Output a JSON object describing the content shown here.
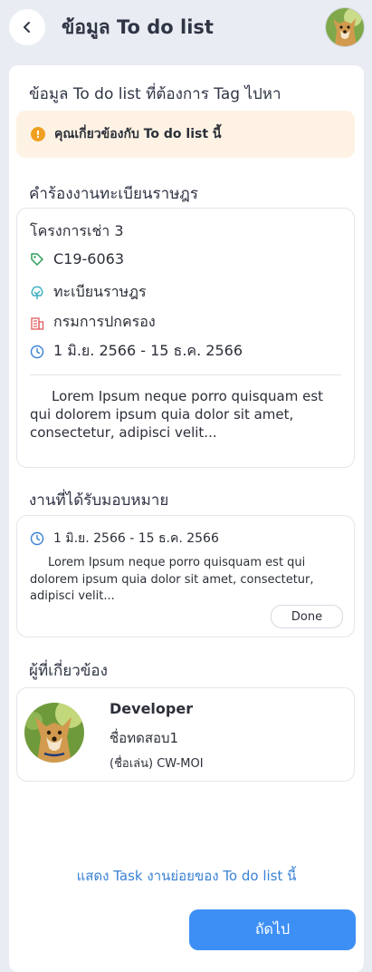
{
  "header": {
    "title": "ข้อมูล To do list",
    "back_icon": "chevron-left-icon",
    "avatar_icon": "user-avatar"
  },
  "section_todo": {
    "title": "ข้อมูล To do list ที่ต้องการ Tag ไปหา",
    "banner": {
      "icon": "info-icon",
      "text": "คุณเกี่ยวข้องกับ To do list นี้",
      "color": "#f0a020"
    }
  },
  "section_request": {
    "title": "คำร้องงานทะเบียนราษฎร",
    "card": {
      "name": "โครงการเช่า 3",
      "code": "C19-6063",
      "category": "ทะเบียนราษฎร",
      "department": "กรมการปกครอง",
      "date_range": "1 มิ.ย. 2566 - 15 ธ.ค. 2566",
      "description": "Lorem Ipsum neque porro quisquam est qui dolorem ipsum quia dolor sit amet, consectetur, adipisci velit..."
    }
  },
  "section_assigned": {
    "title": "งานที่ได้รับมอบหมาย",
    "card": {
      "date_range": "1 มิ.ย. 2566 - 15 ธ.ค. 2566",
      "description": "Lorem Ipsum neque porro quisquam est qui dolorem ipsum quia dolor sit amet, consectetur, adipisci velit...",
      "status_button": "Done"
    }
  },
  "section_related": {
    "title": "ผู้ที่เกี่ยวข้อง",
    "person": {
      "role": "Developer",
      "name": "ชื่อทดสอบ1",
      "nickname": "(ชื่อเล่น) CW-MOI"
    }
  },
  "footer": {
    "link_text": "แสดง Task งานย่อยของ To do list นี้",
    "next_button": "ถัดไป"
  },
  "colors": {
    "accent": "#3d8ff5",
    "link": "#3a82d4",
    "banner_bg": "#fdf2e4",
    "tag_icon": "#2e9e5b",
    "category_icon": "#3aaec0",
    "building_icon": "#e05c5c",
    "clock_icon": "#3a82d4"
  }
}
